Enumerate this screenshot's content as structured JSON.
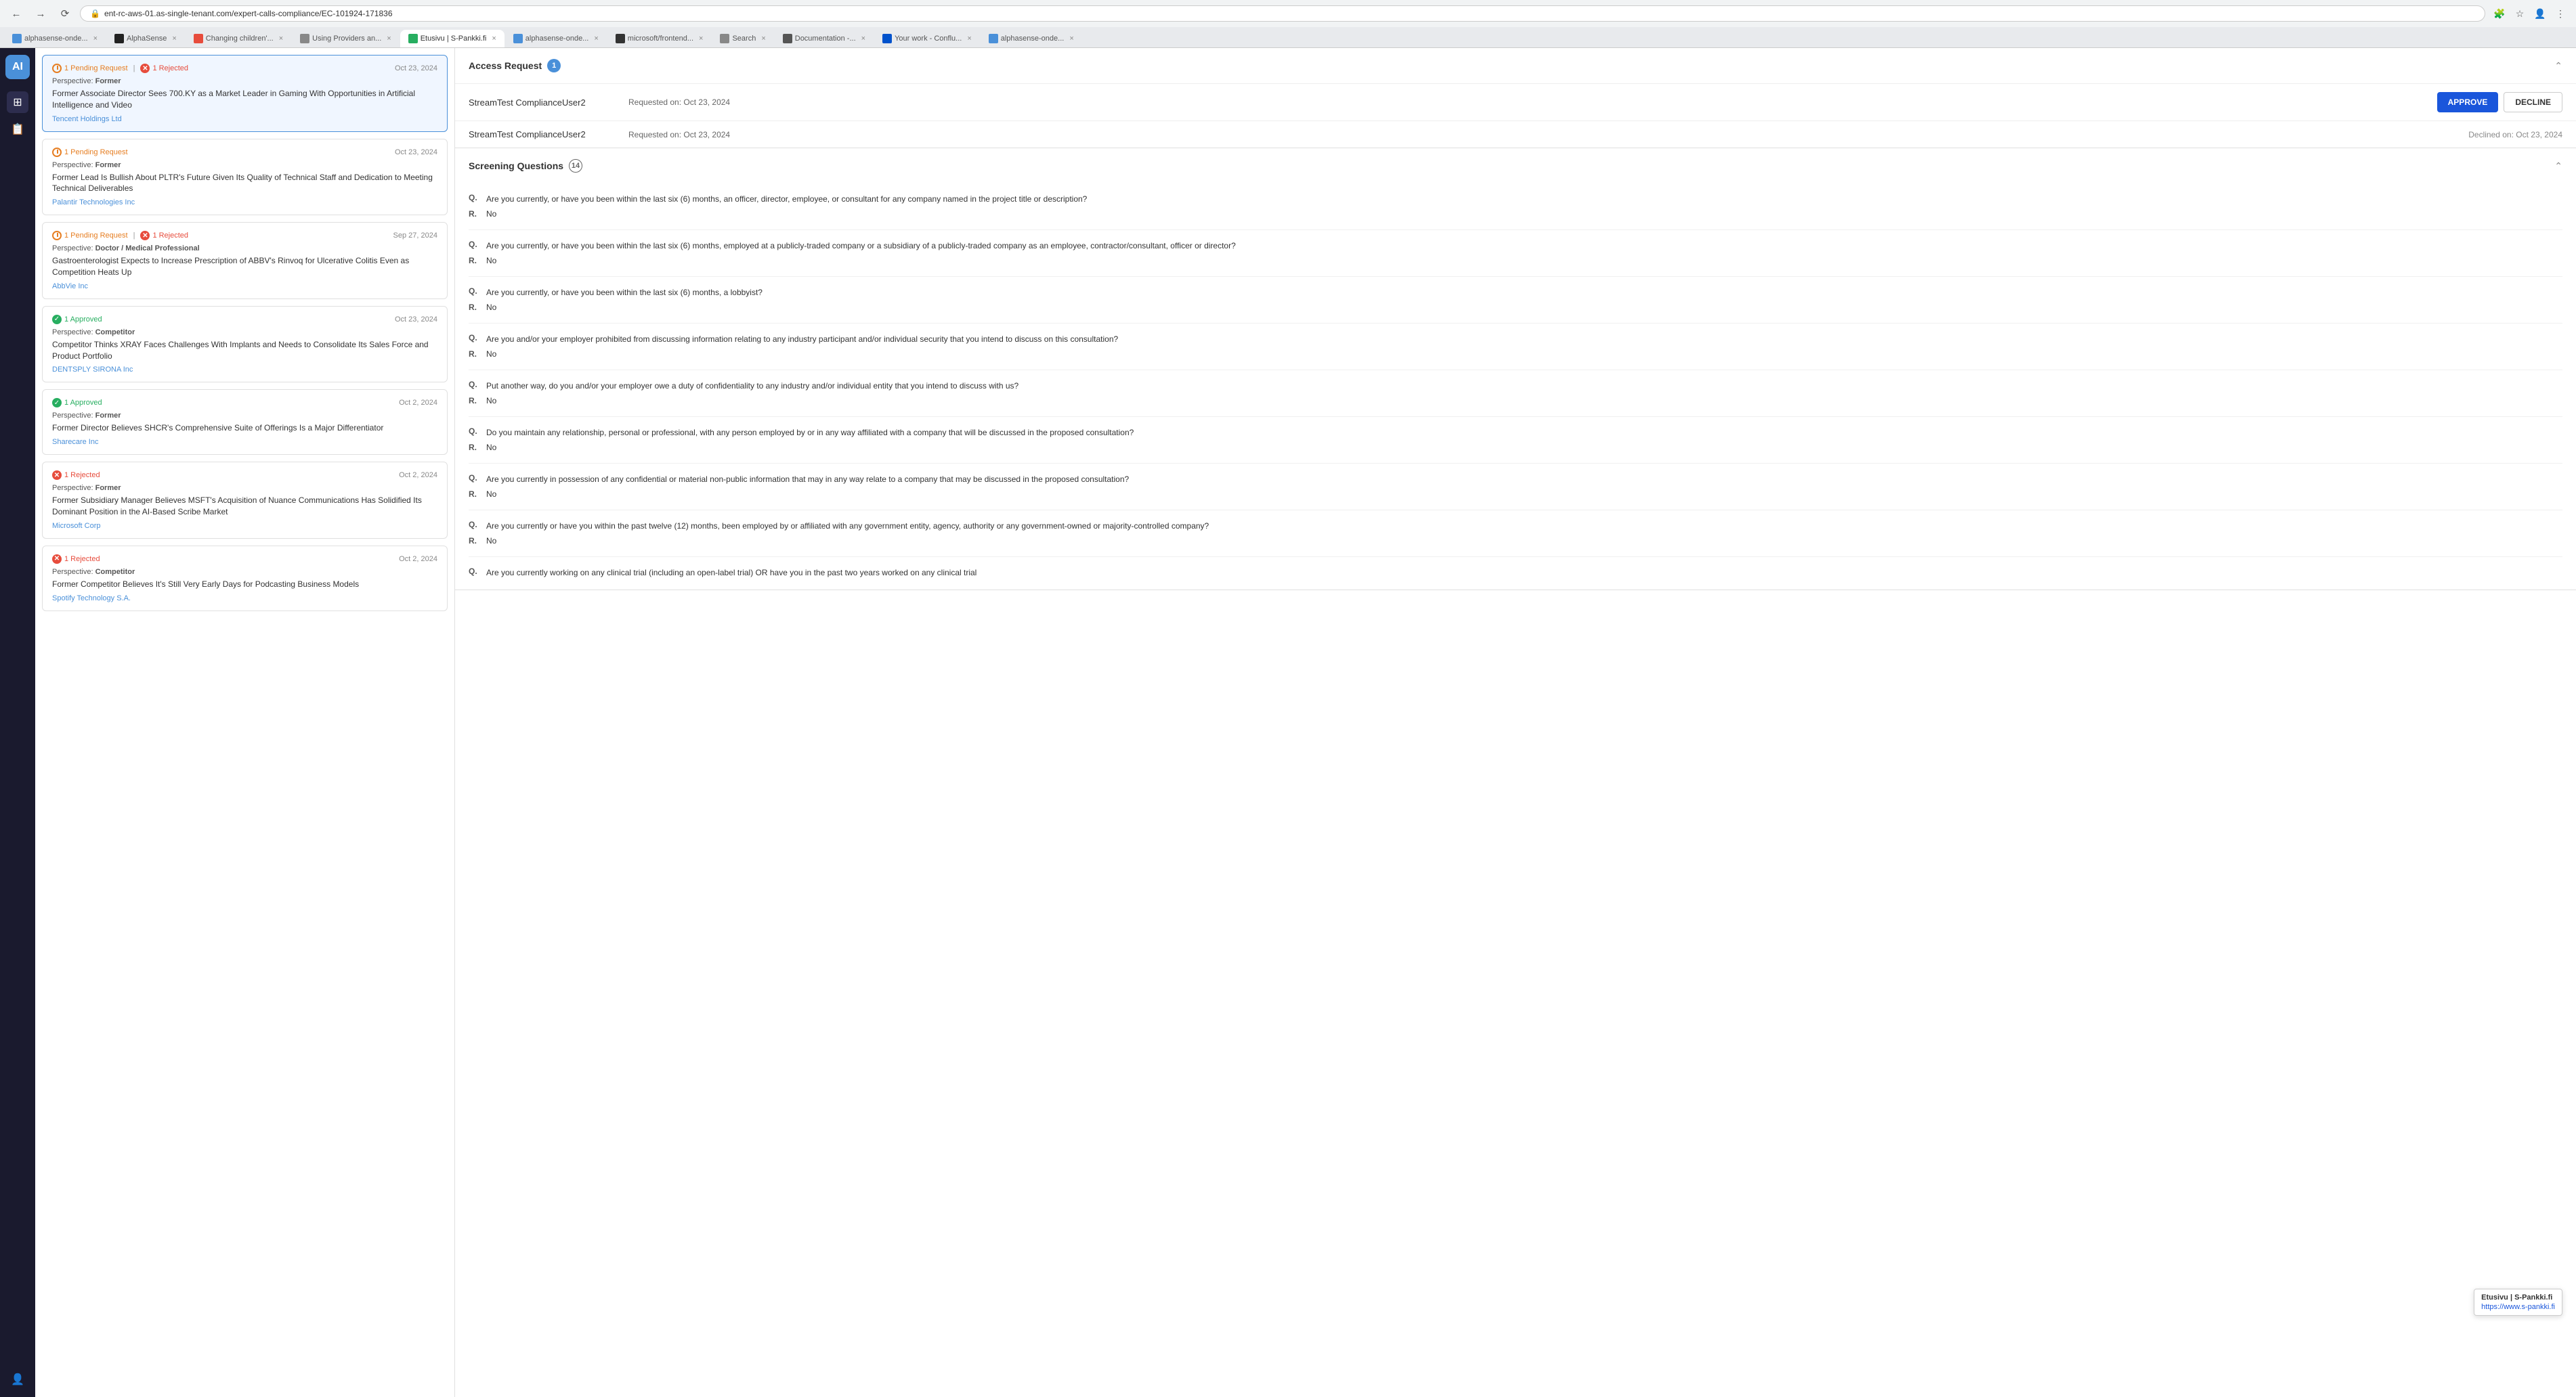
{
  "browser": {
    "url": "ent-rc-aws-01.as-single-tenant.com/expert-calls-compliance/EC-101924-171836",
    "tabs": [
      {
        "label": "alphasense-onde...",
        "active": false,
        "favicon_color": "#4a90d9"
      },
      {
        "label": "AlphaSense",
        "active": false,
        "favicon_color": "#222"
      },
      {
        "label": "Changing children'...",
        "active": false,
        "favicon_color": "#e74c3c"
      },
      {
        "label": "Using Providers an...",
        "active": false,
        "favicon_color": "#888"
      },
      {
        "label": "Etusivu | S-Pankki.fi",
        "active": true,
        "favicon_color": "#27ae60"
      },
      {
        "label": "alphasense-onde...",
        "active": false,
        "favicon_color": "#4a90d9"
      },
      {
        "label": "microsoft/frontend...",
        "active": false,
        "favicon_color": "#333"
      },
      {
        "label": "Search",
        "active": false,
        "favicon_color": "#888"
      },
      {
        "label": "Documentation -...",
        "active": false,
        "favicon_color": "#555"
      },
      {
        "label": "Your work - Conflu...",
        "active": false,
        "favicon_color": "#0052cc"
      },
      {
        "label": "alphasense-onde...",
        "active": false,
        "favicon_color": "#4a90d9"
      }
    ]
  },
  "call_cards": [
    {
      "id": 1,
      "selected": true,
      "pending_count": 1,
      "rejected_count": 1,
      "approved_count": 0,
      "date": "Oct 23, 2024",
      "perspective_label": "Perspective:",
      "perspective": "Former",
      "title": "Former Associate Director Sees 700.KY as a Market Leader in Gaming With Opportunities in Artificial Intelligence and Video",
      "company": "Tencent Holdings Ltd"
    },
    {
      "id": 2,
      "selected": false,
      "pending_count": 1,
      "rejected_count": 0,
      "approved_count": 0,
      "date": "Oct 23, 2024",
      "perspective_label": "Perspective:",
      "perspective": "Former",
      "title": "Former Lead Is Bullish About PLTR's Future Given Its Quality of Technical Staff and Dedication to Meeting Technical Deliverables",
      "company": "Palantir Technologies Inc"
    },
    {
      "id": 3,
      "selected": false,
      "pending_count": 1,
      "rejected_count": 1,
      "approved_count": 0,
      "date": "Sep 27, 2024",
      "perspective_label": "Perspective:",
      "perspective": "Doctor / Medical Professional",
      "title": "Gastroenterologist Expects to Increase Prescription of ABBV's Rinvoq for Ulcerative Colitis Even as Competition Heats Up",
      "company": "AbbVie Inc"
    },
    {
      "id": 4,
      "selected": false,
      "pending_count": 0,
      "rejected_count": 0,
      "approved_count": 1,
      "date": "Oct 23, 2024",
      "perspective_label": "Perspective:",
      "perspective": "Competitor",
      "title": "Competitor Thinks XRAY Faces Challenges With Implants and Needs to Consolidate Its Sales Force and Product Portfolio",
      "company": "DENTSPLY SIRONA Inc"
    },
    {
      "id": 5,
      "selected": false,
      "pending_count": 0,
      "rejected_count": 0,
      "approved_count": 1,
      "date": "Oct 2, 2024",
      "perspective_label": "Perspective:",
      "perspective": "Former",
      "title": "Former Director Believes SHCR's Comprehensive Suite of Offerings Is a Major Differentiator",
      "company": "Sharecare Inc"
    },
    {
      "id": 6,
      "selected": false,
      "pending_count": 0,
      "rejected_count": 1,
      "approved_count": 0,
      "date": "Oct 2, 2024",
      "perspective_label": "Perspective:",
      "perspective": "Former",
      "title": "Former Subsidiary Manager Believes MSFT's Acquisition of Nuance Communications Has Solidified Its Dominant Position in the AI-Based Scribe Market",
      "company": "Microsoft Corp"
    },
    {
      "id": 7,
      "selected": false,
      "pending_count": 0,
      "rejected_count": 1,
      "approved_count": 0,
      "date": "Oct 2, 2024",
      "perspective_label": "Perspective:",
      "perspective": "Competitor",
      "title": "Former Competitor Believes It's Still Very Early Days for Podcasting Business Models",
      "company": "Spotify Technology S.A."
    }
  ],
  "right_panel": {
    "access_request": {
      "section_title": "Access Request",
      "count": 1,
      "rows": [
        {
          "id": 1,
          "name": "StreamTest ComplianceUser2",
          "requested_on": "Requested on: Oct 23, 2024",
          "status": "pending",
          "approve_label": "APPROVE",
          "decline_label": "DECLINE"
        },
        {
          "id": 2,
          "name": "StreamTest ComplianceUser2",
          "requested_on": "Requested on: Oct 23, 2024",
          "status": "declined",
          "declined_text": "Declined on: Oct 23, 2024"
        }
      ]
    },
    "screening_questions": {
      "section_title": "Screening Questions",
      "count": 14,
      "questions": [
        {
          "q": "Are you currently, or have you been within the last six (6) months, an officer, director, employee, or consultant for any company named in the project title or description?",
          "r": "No"
        },
        {
          "q": "Are you currently, or have you been within the last six (6) months, employed at a publicly-traded company or a subsidiary of a publicly-traded company as an employee, contractor/consultant, officer or director?",
          "r": "No"
        },
        {
          "q": "Are you currently, or have you been within the last six (6) months, a lobbyist?",
          "r": "No"
        },
        {
          "q": "Are you and/or your employer prohibited from discussing information relating to any industry participant and/or individual security that you intend to discuss on this consultation?",
          "r": "No"
        },
        {
          "q": "Put another way, do you and/or your employer owe a duty of confidentiality to any industry and/or individual entity that you intend to discuss with us?",
          "r": "No"
        },
        {
          "q": "Do you maintain any relationship, personal or professional, with any person employed by or in any way affiliated with a company that will be discussed in the proposed consultation?",
          "r": "No"
        },
        {
          "q": "Are you currently in possession of any confidential or material non-public information that may in any way relate to a company that may be discussed in the proposed consultation?",
          "r": "No"
        },
        {
          "q": "Are you currently or have you within the past twelve (12) months, been employed by or affiliated with any government entity, agency, authority or any government-owned or majority-controlled company?",
          "r": "No"
        },
        {
          "q": "Are you currently working on any clinical trial (including an open-label trial) OR have you in the past two years worked on any clinical trial",
          "r": ""
        }
      ]
    }
  },
  "tooltip": {
    "title": "Etusivu | S-Pankki.fi",
    "url": "https://www.s-pankki.fi"
  },
  "sidebar": {
    "logo": "AI",
    "icons": [
      "⊞",
      "📋",
      "👤"
    ]
  }
}
